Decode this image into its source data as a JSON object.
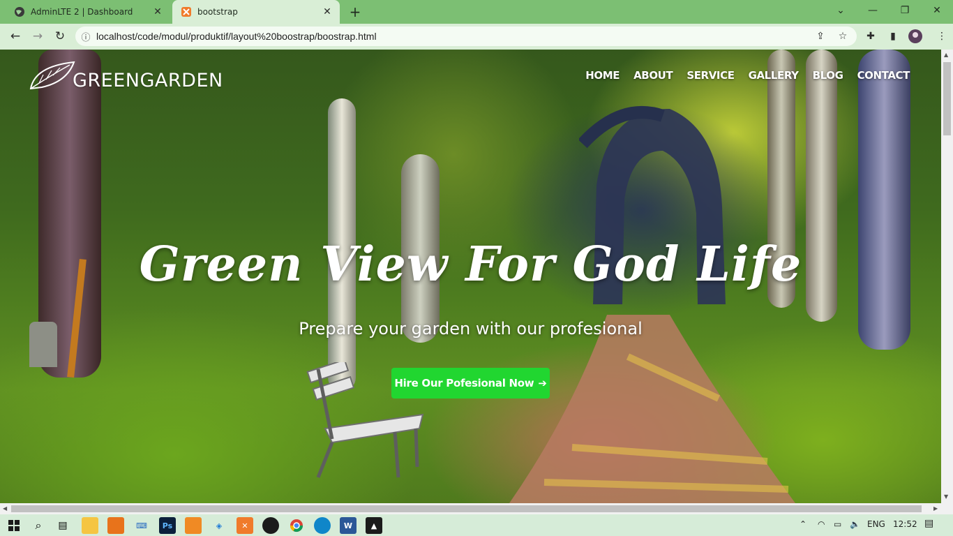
{
  "browser": {
    "tabs": [
      {
        "title": "AdminLTE 2 | Dashboard",
        "icon": "globe-icon",
        "active": false
      },
      {
        "title": "bootstrap",
        "icon": "xampp-icon",
        "active": true
      }
    ],
    "url": "localhost/code/modul/produktif/layout%20boostrap/boostrap.html"
  },
  "site": {
    "brand": "GREENGARDEN",
    "nav": [
      "HOME",
      "ABOUT",
      "SERVICE",
      "GALLERY",
      "BLOG",
      "CONTACT"
    ],
    "headline": "Green View For God Life",
    "subheadline": "Prepare your garden with our profesional",
    "cta_label": "Hire Our Pofesional Now",
    "cta_color": "#21d630"
  },
  "taskbar": {
    "apps": [
      "start-icon",
      "search-icon",
      "task-view-icon",
      "file-explorer-icon",
      "sublime-icon",
      "keyboard-icon",
      "photoshop-icon",
      "orange-app-icon",
      "vscode-icon",
      "xampp-icon",
      "winamp-icon",
      "chrome-icon",
      "edge-icon",
      "word-icon",
      "photos-icon"
    ],
    "language": "ENG",
    "time": "12:52"
  }
}
